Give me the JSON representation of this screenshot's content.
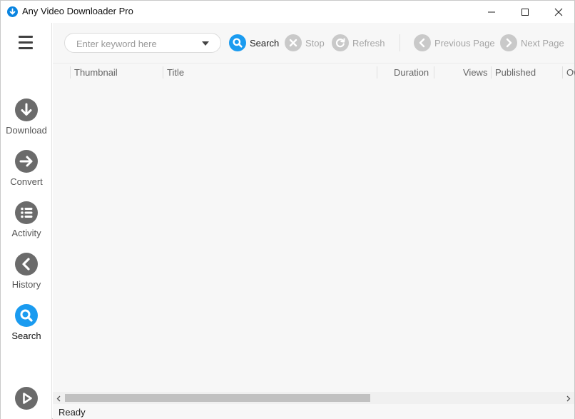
{
  "window": {
    "title": "Any Video Downloader Pro"
  },
  "sidebar": {
    "items": [
      {
        "id": "download",
        "label": "Download",
        "icon": "download-arrow-icon"
      },
      {
        "id": "convert",
        "label": "Convert",
        "icon": "convert-arrow-icon"
      },
      {
        "id": "activity",
        "label": "Activity",
        "icon": "list-icon"
      },
      {
        "id": "history",
        "label": "History",
        "icon": "back-chevron-icon"
      },
      {
        "id": "search",
        "label": "Search",
        "icon": "search-icon",
        "active": true
      }
    ]
  },
  "toolbar": {
    "search_placeholder": "Enter keyword here",
    "search_value": "",
    "search_label": "Search",
    "stop_label": "Stop",
    "refresh_label": "Refresh",
    "prev_label": "Previous Page",
    "next_label": "Next Page"
  },
  "table": {
    "columns": [
      "Thumbnail",
      "Title",
      "Duration",
      "Views",
      "Published",
      "Ow"
    ]
  },
  "status": {
    "text": "Ready"
  },
  "colors": {
    "accent": "#1a9bf0",
    "icon_gray": "#6b6b6b",
    "disabled_gray": "#c9c9c9"
  }
}
